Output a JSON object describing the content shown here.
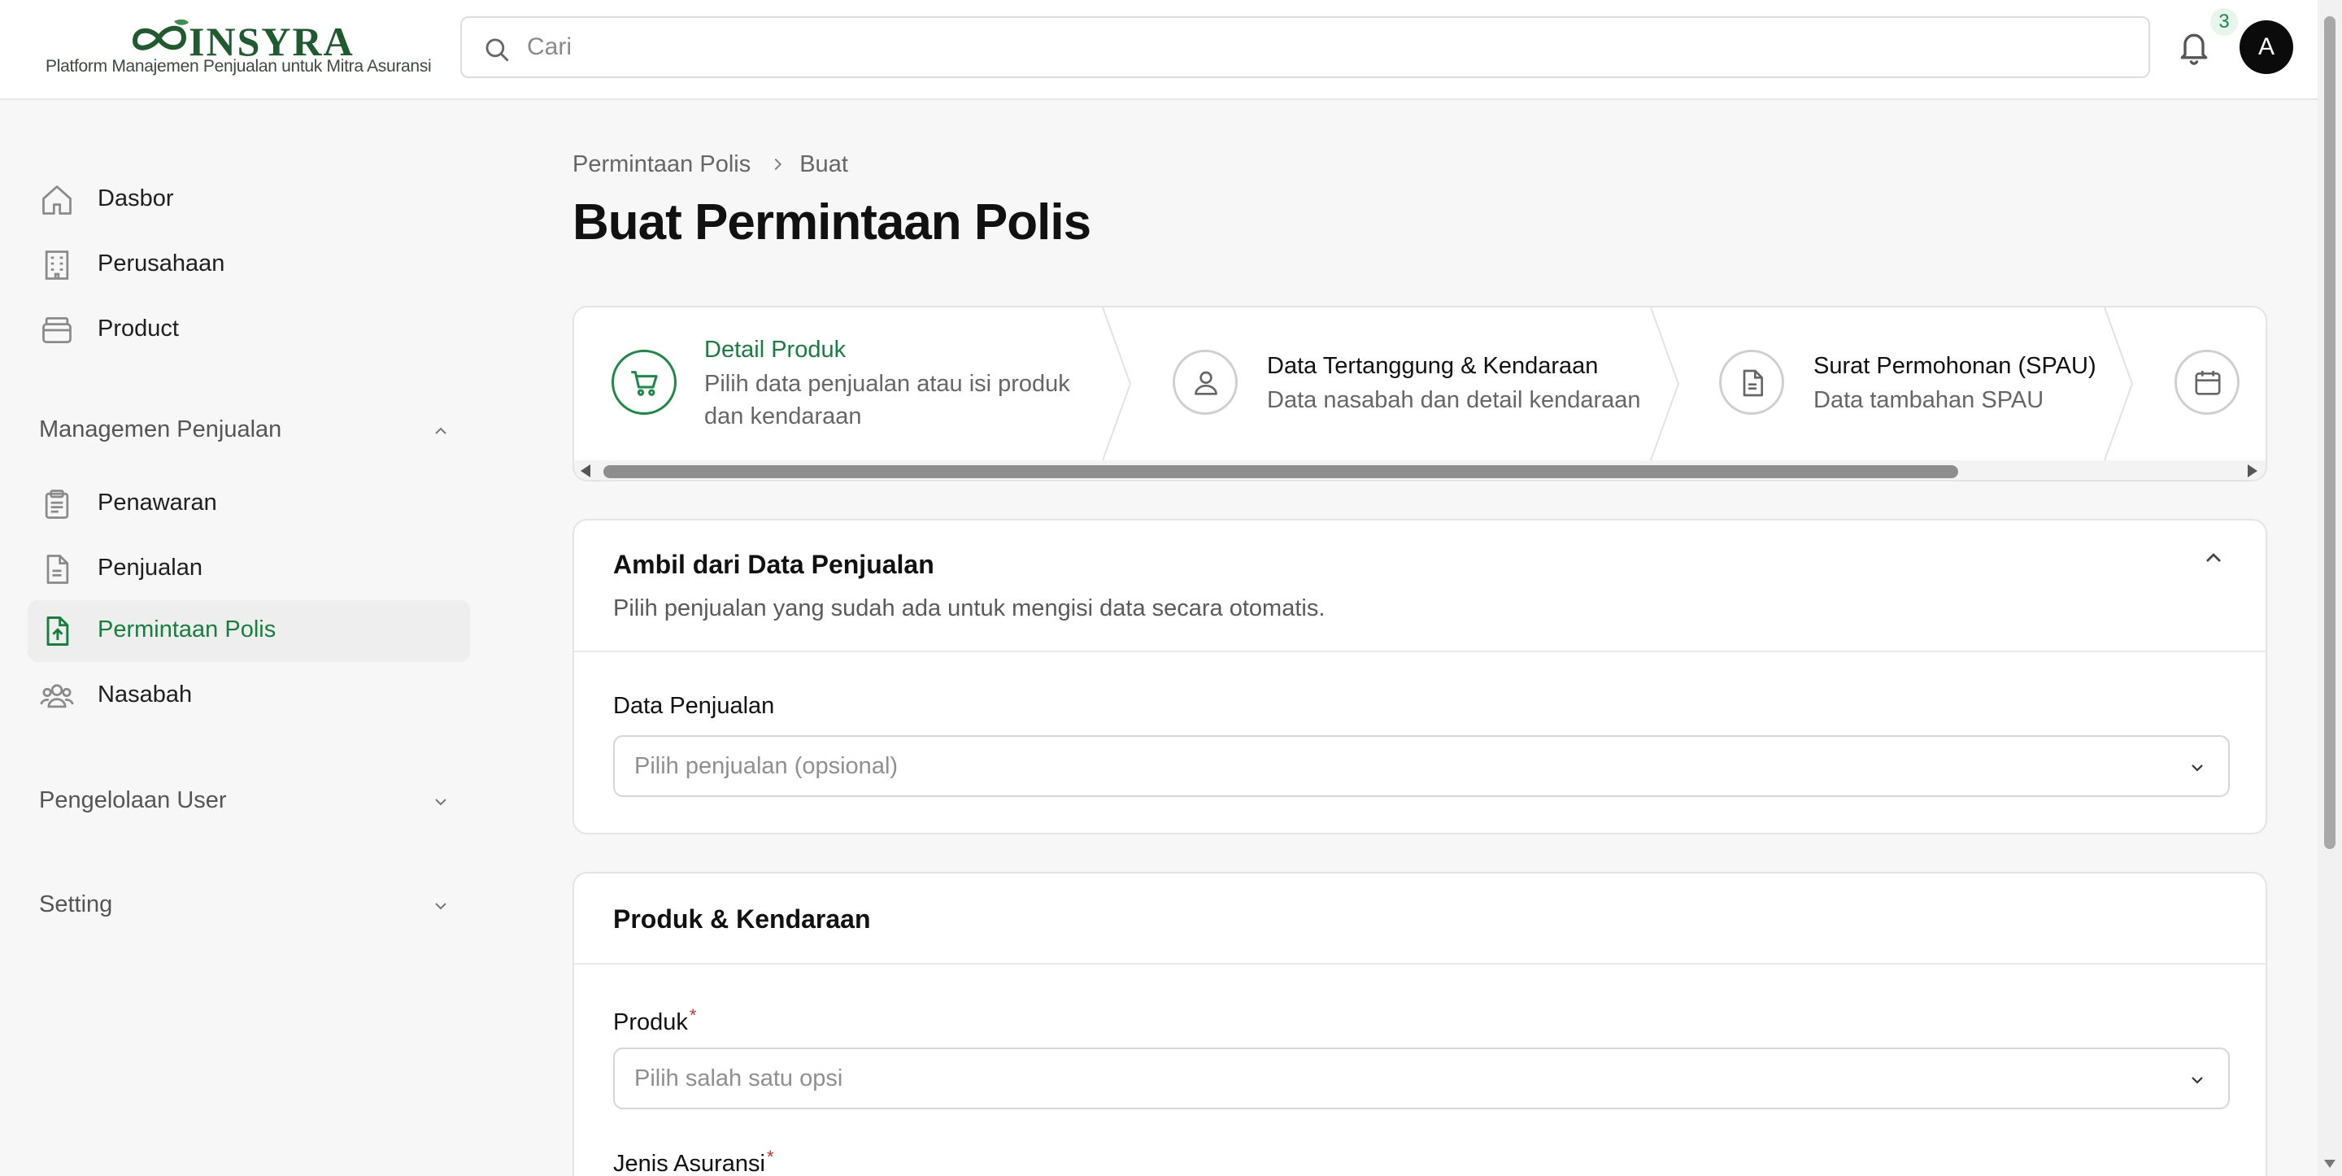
{
  "brand": {
    "name": "INSYRA",
    "tagline": "Platform Manajemen Penjualan untuk Mitra Asuransi",
    "color": "#1f5b2f"
  },
  "header": {
    "search_placeholder": "Cari",
    "notification_count": "3",
    "avatar_initial": "A"
  },
  "sidebar": {
    "items": [
      {
        "label": "Dasbor",
        "icon": "home-icon"
      },
      {
        "label": "Perusahaan",
        "icon": "building-icon"
      },
      {
        "label": "Product",
        "icon": "box-icon"
      }
    ],
    "sections": [
      {
        "label": "Managemen Penjualan",
        "expanded": true,
        "items": [
          {
            "label": "Penawaran",
            "icon": "clipboard-icon"
          },
          {
            "label": "Penjualan",
            "icon": "document-icon"
          },
          {
            "label": "Permintaan Polis",
            "icon": "file-upload-icon",
            "active": true
          },
          {
            "label": "Nasabah",
            "icon": "users-icon"
          }
        ]
      },
      {
        "label": "Pengelolaan User",
        "expanded": false
      },
      {
        "label": "Setting",
        "expanded": false
      }
    ]
  },
  "breadcrumb": {
    "parent": "Permintaan Polis",
    "current": "Buat"
  },
  "page": {
    "title": "Buat Permintaan Polis"
  },
  "stepper": {
    "steps": [
      {
        "title": "Detail Produk",
        "description": "Pilih data penjualan atau isi produk dan kendaraan",
        "icon": "cart-icon",
        "active": true
      },
      {
        "title": "Data Tertanggung & Kendaraan",
        "description": "Data nasabah dan detail kendaraan",
        "icon": "user-icon",
        "active": false
      },
      {
        "title": "Surat Permohonan (SPAU)",
        "description": "Data tambahan SPAU",
        "icon": "document-icon",
        "active": false
      },
      {
        "title": "",
        "description": "",
        "icon": "calendar-icon",
        "active": false
      }
    ]
  },
  "sales_card": {
    "title": "Ambil dari Data Penjualan",
    "subtitle": "Pilih penjualan yang sudah ada untuk mengisi data secara otomatis.",
    "field_label": "Data Penjualan",
    "select_placeholder": "Pilih penjualan (opsional)"
  },
  "product_card": {
    "title": "Produk & Kendaraan",
    "product_label": "Produk",
    "product_placeholder": "Pilih salah satu opsi",
    "insurance_type_label": "Jenis Asuransi",
    "required_mark": "*"
  },
  "colors": {
    "accent": "#15803d",
    "active_bg": "#eeeeee",
    "required": "#d32f2f"
  }
}
